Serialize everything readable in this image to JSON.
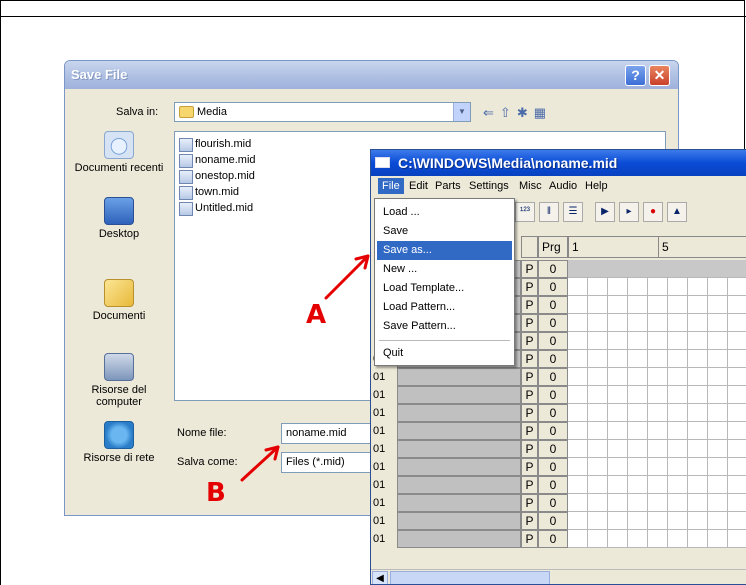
{
  "save_dialog": {
    "title": "Save File",
    "save_in_label": "Salva in:",
    "save_in_value": "Media",
    "places": [
      "Documenti recenti",
      "Desktop",
      "Documenti",
      "Risorse del computer",
      "Risorse di rete"
    ],
    "files": [
      "flourish.mid",
      "noname.mid",
      "onestop.mid",
      "town.mid",
      "Untitled.mid"
    ],
    "filename_label": "Nome file:",
    "filename_value": "noname.mid",
    "savetype_label": "Salva come:",
    "savetype_value": "Files (*.mid)",
    "help_glyph": "?",
    "close_glyph": "✕"
  },
  "sequencer": {
    "title": "C:\\WINDOWS\\Media\\noname.mid",
    "menu": [
      "File",
      "Edit",
      "Parts",
      "Settings",
      "Misc",
      "Audio",
      "Help"
    ],
    "column_prg": "Prg",
    "column_bar1": "1",
    "column_bar5": "5",
    "rows": [
      {
        "num": "",
        "p": "P",
        "prg": "0"
      },
      {
        "num": "",
        "p": "P",
        "prg": "0"
      },
      {
        "num": "",
        "p": "P",
        "prg": "0"
      },
      {
        "num": "",
        "p": "P",
        "prg": "0"
      },
      {
        "num": "",
        "p": "P",
        "prg": "0"
      },
      {
        "num": "01",
        "p": "P",
        "prg": "0"
      },
      {
        "num": "01",
        "p": "P",
        "prg": "0"
      },
      {
        "num": "01",
        "p": "P",
        "prg": "0"
      },
      {
        "num": "01",
        "p": "P",
        "prg": "0"
      },
      {
        "num": "01",
        "p": "P",
        "prg": "0"
      },
      {
        "num": "01",
        "p": "P",
        "prg": "0"
      },
      {
        "num": "01",
        "p": "P",
        "prg": "0"
      },
      {
        "num": "01",
        "p": "P",
        "prg": "0"
      },
      {
        "num": "01",
        "p": "P",
        "prg": "0"
      },
      {
        "num": "01",
        "p": "P",
        "prg": "0"
      },
      {
        "num": "01",
        "p": "P",
        "prg": "0"
      }
    ]
  },
  "file_menu": {
    "items": [
      "Load ...",
      "Save",
      "Save as...",
      "New ...",
      "Load Template...",
      "Load Pattern...",
      "Save Pattern...",
      "Quit"
    ],
    "highlighted": "Save as..."
  },
  "annotations": {
    "a": "A",
    "b": "B",
    "color": "#e40000"
  }
}
